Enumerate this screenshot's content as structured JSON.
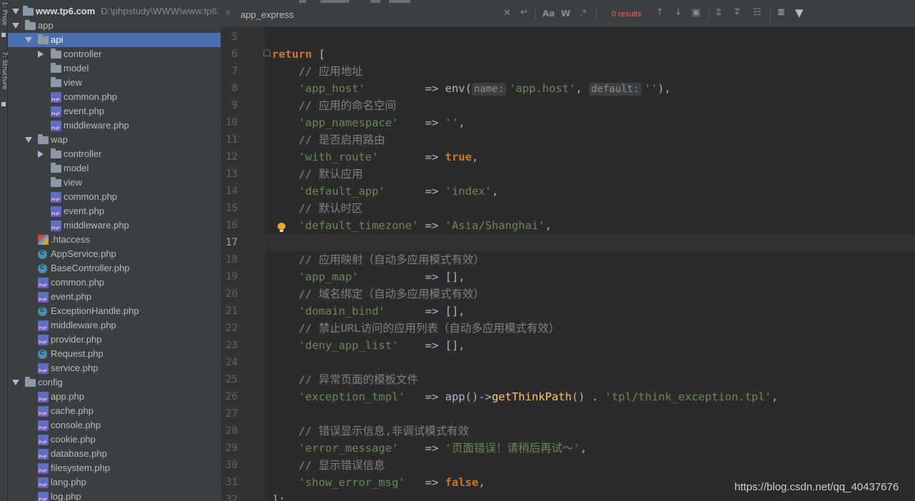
{
  "toolstrip": {
    "project_label": "1: Proje",
    "structure_label": "7: Structure"
  },
  "project_tree": {
    "root": {
      "label": "www.tp6.com",
      "hint": "D:\\phpstudy\\WWW\\www.tp6."
    },
    "items": [
      {
        "label": "app",
        "type": "folder",
        "level": 1,
        "expanded": true
      },
      {
        "label": "api",
        "type": "folder",
        "level": 2,
        "expanded": true,
        "selected": true
      },
      {
        "label": "controller",
        "type": "folder",
        "level": 3,
        "expanded": false
      },
      {
        "label": "model",
        "type": "folder",
        "level": 3
      },
      {
        "label": "view",
        "type": "folder",
        "level": 3
      },
      {
        "label": "common.php",
        "type": "php",
        "level": 3
      },
      {
        "label": "event.php",
        "type": "php",
        "level": 3
      },
      {
        "label": "middleware.php",
        "type": "php",
        "level": 3
      },
      {
        "label": "wap",
        "type": "folder",
        "level": 2,
        "expanded": true
      },
      {
        "label": "controller",
        "type": "folder",
        "level": 3,
        "expanded": false
      },
      {
        "label": "model",
        "type": "folder",
        "level": 3
      },
      {
        "label": "view",
        "type": "folder",
        "level": 3
      },
      {
        "label": "common.php",
        "type": "php",
        "level": 3
      },
      {
        "label": "event.php",
        "type": "php",
        "level": 3
      },
      {
        "label": "middleware.php",
        "type": "php",
        "level": 3
      },
      {
        "label": ".htaccess",
        "type": "htaccess",
        "level": 2
      },
      {
        "label": "AppService.php",
        "type": "class",
        "level": 2
      },
      {
        "label": "BaseController.php",
        "type": "class",
        "level": 2
      },
      {
        "label": "common.php",
        "type": "php",
        "level": 2
      },
      {
        "label": "event.php",
        "type": "php",
        "level": 2
      },
      {
        "label": "ExceptionHandle.php",
        "type": "class",
        "level": 2
      },
      {
        "label": "middleware.php",
        "type": "php",
        "level": 2
      },
      {
        "label": "provider.php",
        "type": "php",
        "level": 2
      },
      {
        "label": "Request.php",
        "type": "class",
        "level": 2
      },
      {
        "label": "service.php",
        "type": "php",
        "level": 2
      },
      {
        "label": "config",
        "type": "folder",
        "level": 1,
        "expanded": true
      },
      {
        "label": "app.php",
        "type": "php",
        "level": 2
      },
      {
        "label": "cache.php",
        "type": "php",
        "level": 2
      },
      {
        "label": "console.php",
        "type": "php",
        "level": 2
      },
      {
        "label": "cookie.php",
        "type": "php",
        "level": 2
      },
      {
        "label": "database.php",
        "type": "php",
        "level": 2
      },
      {
        "label": "filesystem.php",
        "type": "php",
        "level": 2
      },
      {
        "label": "lang.php",
        "type": "php",
        "level": 2
      },
      {
        "label": "log.php",
        "type": "php",
        "level": 2
      }
    ]
  },
  "search": {
    "query": "app_express",
    "results": "0 results",
    "match_case": "Aa",
    "words": "W",
    "regex": ".*"
  },
  "editor": {
    "current_line": "17",
    "lines": [
      {
        "n": "5",
        "tokens": []
      },
      {
        "n": "6",
        "tokens": [
          [
            "kw",
            "return "
          ],
          [
            "op",
            "["
          ]
        ]
      },
      {
        "n": "7",
        "tokens": [
          [
            "cm",
            "    // 应用地址"
          ]
        ]
      },
      {
        "n": "8",
        "tokens": [
          [
            "str",
            "    'app_host'"
          ],
          [
            "op",
            "         => env("
          ],
          [
            "hint",
            "name:"
          ],
          [
            "str",
            "'app.host'"
          ],
          [
            "op",
            ", "
          ],
          [
            "hint",
            "default:"
          ],
          [
            "str",
            "''"
          ],
          [
            "op",
            "),"
          ]
        ]
      },
      {
        "n": "9",
        "tokens": [
          [
            "cm",
            "    // 应用的命名空间"
          ]
        ]
      },
      {
        "n": "10",
        "tokens": [
          [
            "str",
            "    'app_namespace'"
          ],
          [
            "op",
            "    => "
          ],
          [
            "str",
            "''"
          ],
          [
            "op",
            ","
          ]
        ]
      },
      {
        "n": "11",
        "tokens": [
          [
            "cm",
            "    // 是否启用路由"
          ]
        ]
      },
      {
        "n": "12",
        "tokens": [
          [
            "str",
            "    'with_route'"
          ],
          [
            "op",
            "       => "
          ],
          [
            "kw",
            "true"
          ],
          [
            "op",
            ","
          ]
        ]
      },
      {
        "n": "13",
        "tokens": [
          [
            "cm",
            "    // 默认应用"
          ]
        ]
      },
      {
        "n": "14",
        "tokens": [
          [
            "str",
            "    'default_app'"
          ],
          [
            "op",
            "      => "
          ],
          [
            "str",
            "'index'"
          ],
          [
            "op",
            ","
          ]
        ]
      },
      {
        "n": "15",
        "tokens": [
          [
            "cm",
            "    // 默认时区"
          ]
        ]
      },
      {
        "n": "16",
        "tokens": [
          [
            "str",
            "    'default_timezone'"
          ],
          [
            "op",
            " => "
          ],
          [
            "str",
            "'Asia/Shanghai'"
          ],
          [
            "op",
            ","
          ]
        ]
      },
      {
        "n": "17",
        "tokens": []
      },
      {
        "n": "18",
        "tokens": [
          [
            "cm",
            "    // 应用映射（自动多应用模式有效）"
          ]
        ]
      },
      {
        "n": "19",
        "tokens": [
          [
            "str",
            "    'app_map'"
          ],
          [
            "op",
            "          => [],"
          ]
        ]
      },
      {
        "n": "20",
        "tokens": [
          [
            "cm",
            "    // 域名绑定（自动多应用模式有效）"
          ]
        ]
      },
      {
        "n": "21",
        "tokens": [
          [
            "str",
            "    'domain_bind'"
          ],
          [
            "op",
            "      => [],"
          ]
        ]
      },
      {
        "n": "22",
        "tokens": [
          [
            "cm",
            "    // 禁止URL访问的应用列表（自动多应用模式有效）"
          ]
        ]
      },
      {
        "n": "23",
        "tokens": [
          [
            "str",
            "    'deny_app_list'"
          ],
          [
            "op",
            "    => [],"
          ]
        ]
      },
      {
        "n": "24",
        "tokens": []
      },
      {
        "n": "25",
        "tokens": [
          [
            "cm",
            "    // 异常页面的模板文件"
          ]
        ]
      },
      {
        "n": "26",
        "tokens": [
          [
            "str",
            "    'exception_tmpl'"
          ],
          [
            "op",
            "   => app()->"
          ],
          [
            "fn",
            "getThinkPath"
          ],
          [
            "op",
            "() . "
          ],
          [
            "str",
            "'tpl/think_exception.tpl'"
          ],
          [
            "op",
            ","
          ]
        ]
      },
      {
        "n": "27",
        "tokens": []
      },
      {
        "n": "28",
        "tokens": [
          [
            "cm",
            "    // 错误显示信息,非调试模式有效"
          ]
        ]
      },
      {
        "n": "29",
        "tokens": [
          [
            "str",
            "    'error_message'"
          ],
          [
            "op",
            "    => "
          ],
          [
            "str",
            "'页面错误！请稍后再试～'"
          ],
          [
            "op",
            ","
          ]
        ]
      },
      {
        "n": "30",
        "tokens": [
          [
            "cm",
            "    // 显示错误信息"
          ]
        ]
      },
      {
        "n": "31",
        "tokens": [
          [
            "str",
            "    'show_error_msg'"
          ],
          [
            "op",
            "   => "
          ],
          [
            "kw",
            "false"
          ],
          [
            "op",
            ","
          ]
        ]
      },
      {
        "n": "32",
        "tokens": [
          [
            "op",
            "];"
          ]
        ]
      }
    ]
  },
  "watermark": "https://blog.csdn.net/qq_40437676"
}
